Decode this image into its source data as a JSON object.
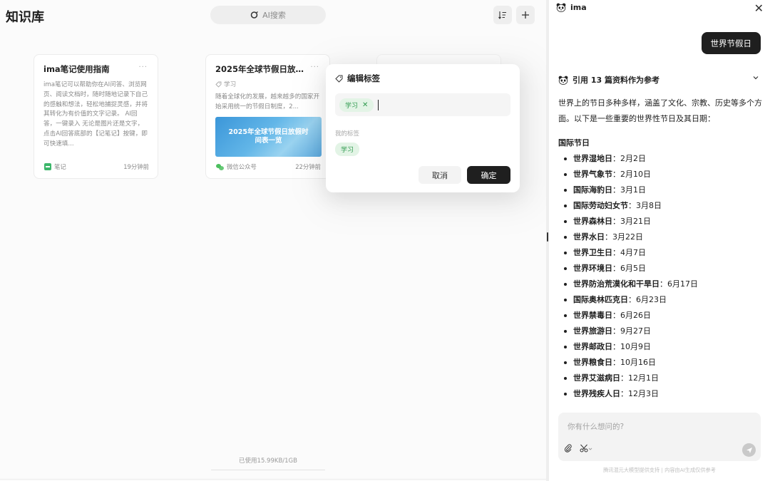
{
  "kb": {
    "title": "知识库",
    "search_placeholder": "AI搜索",
    "usage": "已使用15.99KB/1GB",
    "cards": [
      {
        "title": "ima笔记使用指南",
        "more": "···",
        "body": "ima笔记可以帮助你在AI问答、浏览网页、阅读文档时，随时随地记录下自己的感触和想法，轻松地捕捉灵感，并将其转化为有价值的文字记录。 AI回答，一键录入 无论是图片还是文字，点击AI回答底部的【记笔记】按键，即可快速填...",
        "source": "笔记",
        "time": "19分钟前"
      },
      {
        "title": "2025年全球节假日放假...",
        "more": "···",
        "tag": "学习",
        "body": "随着全球化的发展，越来越多的国家开始采用统一的节假日制度，2...",
        "image_line1": "2025年全球节假日放假时",
        "image_line2": "间表一览",
        "source": "微信公众号",
        "time": "22分钟前"
      }
    ]
  },
  "modal": {
    "title": "编辑标签",
    "current_tag": "学习",
    "my_tags_label": "我的标签",
    "my_tags": [
      "学习"
    ],
    "cancel_label": "取消",
    "ok_label": "确定"
  },
  "chat": {
    "app_name": "ima",
    "user_message": "世界节假日",
    "reference_text": "引用 13 篇资料作为参考",
    "answer_intro": "世界上的节日多种多样，涵盖了文化、宗教、历史等多个方面。以下是一些重要的世界性节日及其日期：",
    "section_title": "国际节日",
    "holidays": [
      {
        "name": "世界湿地日",
        "date": "2月2日"
      },
      {
        "name": "世界气象节",
        "date": "2月10日"
      },
      {
        "name": "国际海豹日",
        "date": "3月1日"
      },
      {
        "name": "国际劳动妇女节",
        "date": "3月8日"
      },
      {
        "name": "世界森林日",
        "date": "3月21日"
      },
      {
        "name": "世界水日",
        "date": "3月22日"
      },
      {
        "name": "世界卫生日",
        "date": "4月7日"
      },
      {
        "name": "世界环境日",
        "date": "6月5日"
      },
      {
        "name": "世界防治荒漠化和干旱日",
        "date": "6月17日"
      },
      {
        "name": "国际奥林匹克日",
        "date": "6月23日"
      },
      {
        "name": "世界禁毒日",
        "date": "6月26日"
      },
      {
        "name": "世界旅游日",
        "date": "9月27日"
      },
      {
        "name": "世界邮政日",
        "date": "10月9日"
      },
      {
        "name": "世界粮食日",
        "date": "10月16日"
      },
      {
        "name": "世界艾滋病日",
        "date": "12月1日"
      },
      {
        "name": "世界残疾人日",
        "date": "12月3日"
      }
    ],
    "input_placeholder": "你有什么想问的?",
    "footer_note": "腾讯混元大模型提供支持 | 内容由AI生成仅供参考"
  },
  "colors": {
    "accent_dark": "#1f1f1f",
    "tag_green": "#2f9a4e",
    "tag_bg": "#e3f4e6"
  }
}
